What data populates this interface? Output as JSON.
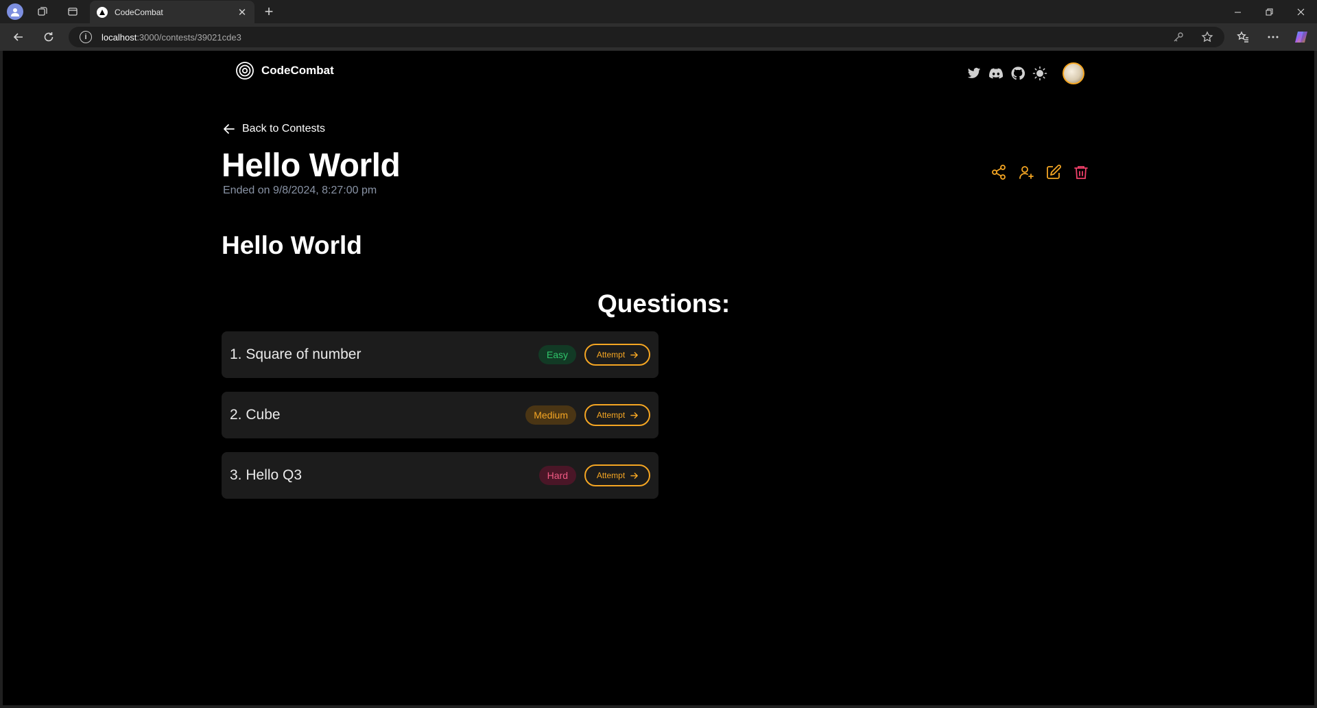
{
  "browser": {
    "tab_title": "CodeCombat",
    "url_host": "localhost",
    "url_path": ":3000/contests/39021cde3"
  },
  "site": {
    "brand": "CodeCombat"
  },
  "contest": {
    "back_label": "Back to Contests",
    "title": "Hello World",
    "ended": "Ended on 9/8/2024, 8:27:00 pm",
    "description": "Hello World",
    "questions_heading": "Questions:"
  },
  "questions": [
    {
      "title": "1. Square of number",
      "difficulty": "Easy",
      "attempt": "Attempt"
    },
    {
      "title": "2. Cube",
      "difficulty": "Medium",
      "attempt": "Attempt"
    },
    {
      "title": "3. Hello Q3",
      "difficulty": "Hard",
      "attempt": "Attempt"
    }
  ],
  "colors": {
    "accent": "#f5a623",
    "danger": "#f0406a",
    "easy": "#2fc46a",
    "medium": "#f5a623",
    "hard": "#f05a84"
  }
}
